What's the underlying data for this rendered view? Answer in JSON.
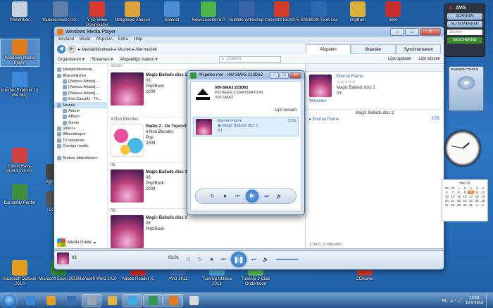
{
  "desktop_icons": [
    {
      "label": "Prullenbak",
      "color": "#c7d2dc"
    },
    {
      "label": "Youtube Music Do...",
      "color": "#5d7fa7"
    },
    {
      "label": "YTD Video Downloader",
      "color": "#d83a2e"
    },
    {
      "label": "Nzbgoogle Zoeken",
      "color": "#e0a33a"
    },
    {
      "label": "Spotnet",
      "color": "#4d8fd6"
    },
    {
      "label": "NewsLeecher 5.0",
      "color": "#4eb34a"
    },
    {
      "label": "Subtitle Workshop",
      "color": "#3a64a9"
    },
    {
      "label": "ConvertXToDVD 5",
      "color": "#d33b2b"
    },
    {
      "label": "DAEMON Tools Lite",
      "color": "#2d68b5"
    },
    {
      "label": "ImgBurn",
      "color": "#d9b23a"
    },
    {
      "label": "Nero",
      "color": "#c62d2d"
    },
    {
      "label": "Windows Media Player",
      "color": "#e27b1c"
    },
    {
      "label": "Internet Explorer 10 (64 bits)",
      "color": "#3b8ad9"
    },
    {
      "label": "Canon Easy-PhotoPrint EX",
      "color": "#d04040"
    },
    {
      "label": "MP N...",
      "color": "#444444"
    },
    {
      "label": "CanonMy Printer",
      "color": "#3f8f3a"
    },
    {
      "label": "OS...",
      "color": "#555555"
    },
    {
      "label": "Microsoft Outlook 2010",
      "color": "#e39e1f"
    },
    {
      "label": "Microsoft Excel 2010",
      "color": "#2f8a3e"
    },
    {
      "label": "Microsoft Word 2010",
      "color": "#2d5faf"
    },
    {
      "label": "Adobe Reader XI",
      "color": "#c82a2a"
    },
    {
      "label": "AVG 2013",
      "color": "#3a6fb7"
    },
    {
      "label": "TuneUp Utilities 2013",
      "color": "#4aa8d8"
    },
    {
      "label": "TuneUp 1-Click Onderhoud",
      "color": "#5cb85c"
    },
    {
      "label": "CCleaner",
      "color": "#d33b2b"
    }
  ],
  "wmp": {
    "title": "Windows Media Player",
    "menu": [
      "Bestand",
      "Beeld",
      "Afspelen",
      "Extra",
      "Help"
    ],
    "breadcrumb": [
      "Mediabibliotheek",
      "Muziek",
      "Alle muziek"
    ],
    "tabs": [
      "Afspelen",
      "Branden",
      "Synchroniseren"
    ],
    "toolbar": {
      "organize": "Organiseren",
      "stream": "Streamen",
      "create_playlist": "Afspeellijst maken",
      "search_placeholder": "Zoeken",
      "save_list": "Lijst opslaan",
      "clear_list": "Lijst wissen"
    },
    "nav": [
      {
        "label": "Mediabibliotheek",
        "indent": 0
      },
      {
        "label": "Afspeellijsten",
        "indent": 0
      },
      {
        "label": "[Various Artists]...",
        "indent": 1
      },
      {
        "label": "[Various Artists]...",
        "indent": 1
      },
      {
        "label": "[Various Artists]...",
        "indent": 1
      },
      {
        "label": "Eva Cassidy - Th...",
        "indent": 1
      },
      {
        "label": "Muziek",
        "indent": 0,
        "selected": true
      },
      {
        "label": "Artiest",
        "indent": 1
      },
      {
        "label": "Album",
        "indent": 1
      },
      {
        "label": "Genre",
        "indent": 1
      },
      {
        "label": "Video's",
        "indent": 0
      },
      {
        "label": "Afbeeldingen",
        "indent": 0
      },
      {
        "label": "Tv-opnamen",
        "indent": 0
      },
      {
        "label": "Overige media",
        "indent": 0
      },
      {
        "label": "",
        "indent": 0
      },
      {
        "label": "Andere bibliotheken",
        "indent": 0
      }
    ],
    "media_guide": "Media Guide",
    "library": {
      "column_header": "Album",
      "albums": [
        {
          "group": "",
          "cover": "magic",
          "title": "Magic Ballads disc 2",
          "num": "03",
          "genre": "Pop/Rock",
          "year": "2009"
        },
        {
          "group": "4 Non Blondes",
          "cover": "topc",
          "title": "Radio 2 - De Topcolle...",
          "num": "4 Non Blondes",
          "genre": "Pop",
          "year": "2009"
        },
        {
          "group": "06",
          "cover": "magic",
          "title": "Magic Ballads disc 1",
          "num": "06",
          "genre": "Pop/Rock",
          "year": "2009"
        },
        {
          "group": "08",
          "cover": "magic",
          "title": "Magic Ballads disc 1",
          "num": "08",
          "genre": "Pop/Rock",
          "year": ""
        }
      ]
    },
    "now_playing": {
      "title": "Eternal Flame",
      "stars": "☆☆☆☆☆",
      "album": "Magic Ballads disc 2",
      "num": "03",
      "cast_label": "Winkelen",
      "playlist_title": "Magic Ballads disc 2",
      "tracks": [
        {
          "title": "Eternal Flame",
          "duration": "3:55"
        }
      ],
      "footer": "1 item, 3 minuten"
    },
    "playbar": {
      "track_num": "03",
      "elapsed": "01:01"
    }
  },
  "dialog": {
    "title": "Afspelen met - XW-SMA3 223D62",
    "device_name": "XW-SMA3 223D62",
    "manufacturer": "PIONEER CORPORATION",
    "model": "XW-SMA3",
    "clear_list": "Lijst wissen",
    "track": {
      "title": "Eternal Flame",
      "album": "Magic Ballads disc 2",
      "num": "03",
      "duration": "3:55"
    }
  },
  "avg": {
    "brand": "AVG",
    "scan_btn": "SCANNEN",
    "update_btn": "NU BIJWERKEN",
    "search_placeholder": "Zoeken",
    "status": "BESCHERMD"
  },
  "daemon_label": "DAEMON TOOLS",
  "calendar": {
    "month": "mei 13",
    "today": "10",
    "days": [
      "29",
      "30",
      "1",
      "2",
      "3",
      "4",
      "5",
      "6",
      "7",
      "8",
      "9",
      "10",
      "11",
      "12",
      "13",
      "14",
      "15",
      "16",
      "17",
      "18",
      "19",
      "20",
      "21",
      "22",
      "23",
      "24",
      "25",
      "26",
      "27",
      "28",
      "29",
      "30",
      "31",
      "1",
      "2"
    ]
  },
  "taskbar": {
    "apps": [
      "#3b8ad9",
      "#e39e1f",
      "#3a6fb7",
      "#9aa5b0",
      "#e2b447",
      "#3fa9e6",
      "#2f9a4f",
      "#e27b1c",
      "#d9d9d9"
    ],
    "lang": "NL",
    "time": "13:53",
    "date": "10-5-2013"
  }
}
